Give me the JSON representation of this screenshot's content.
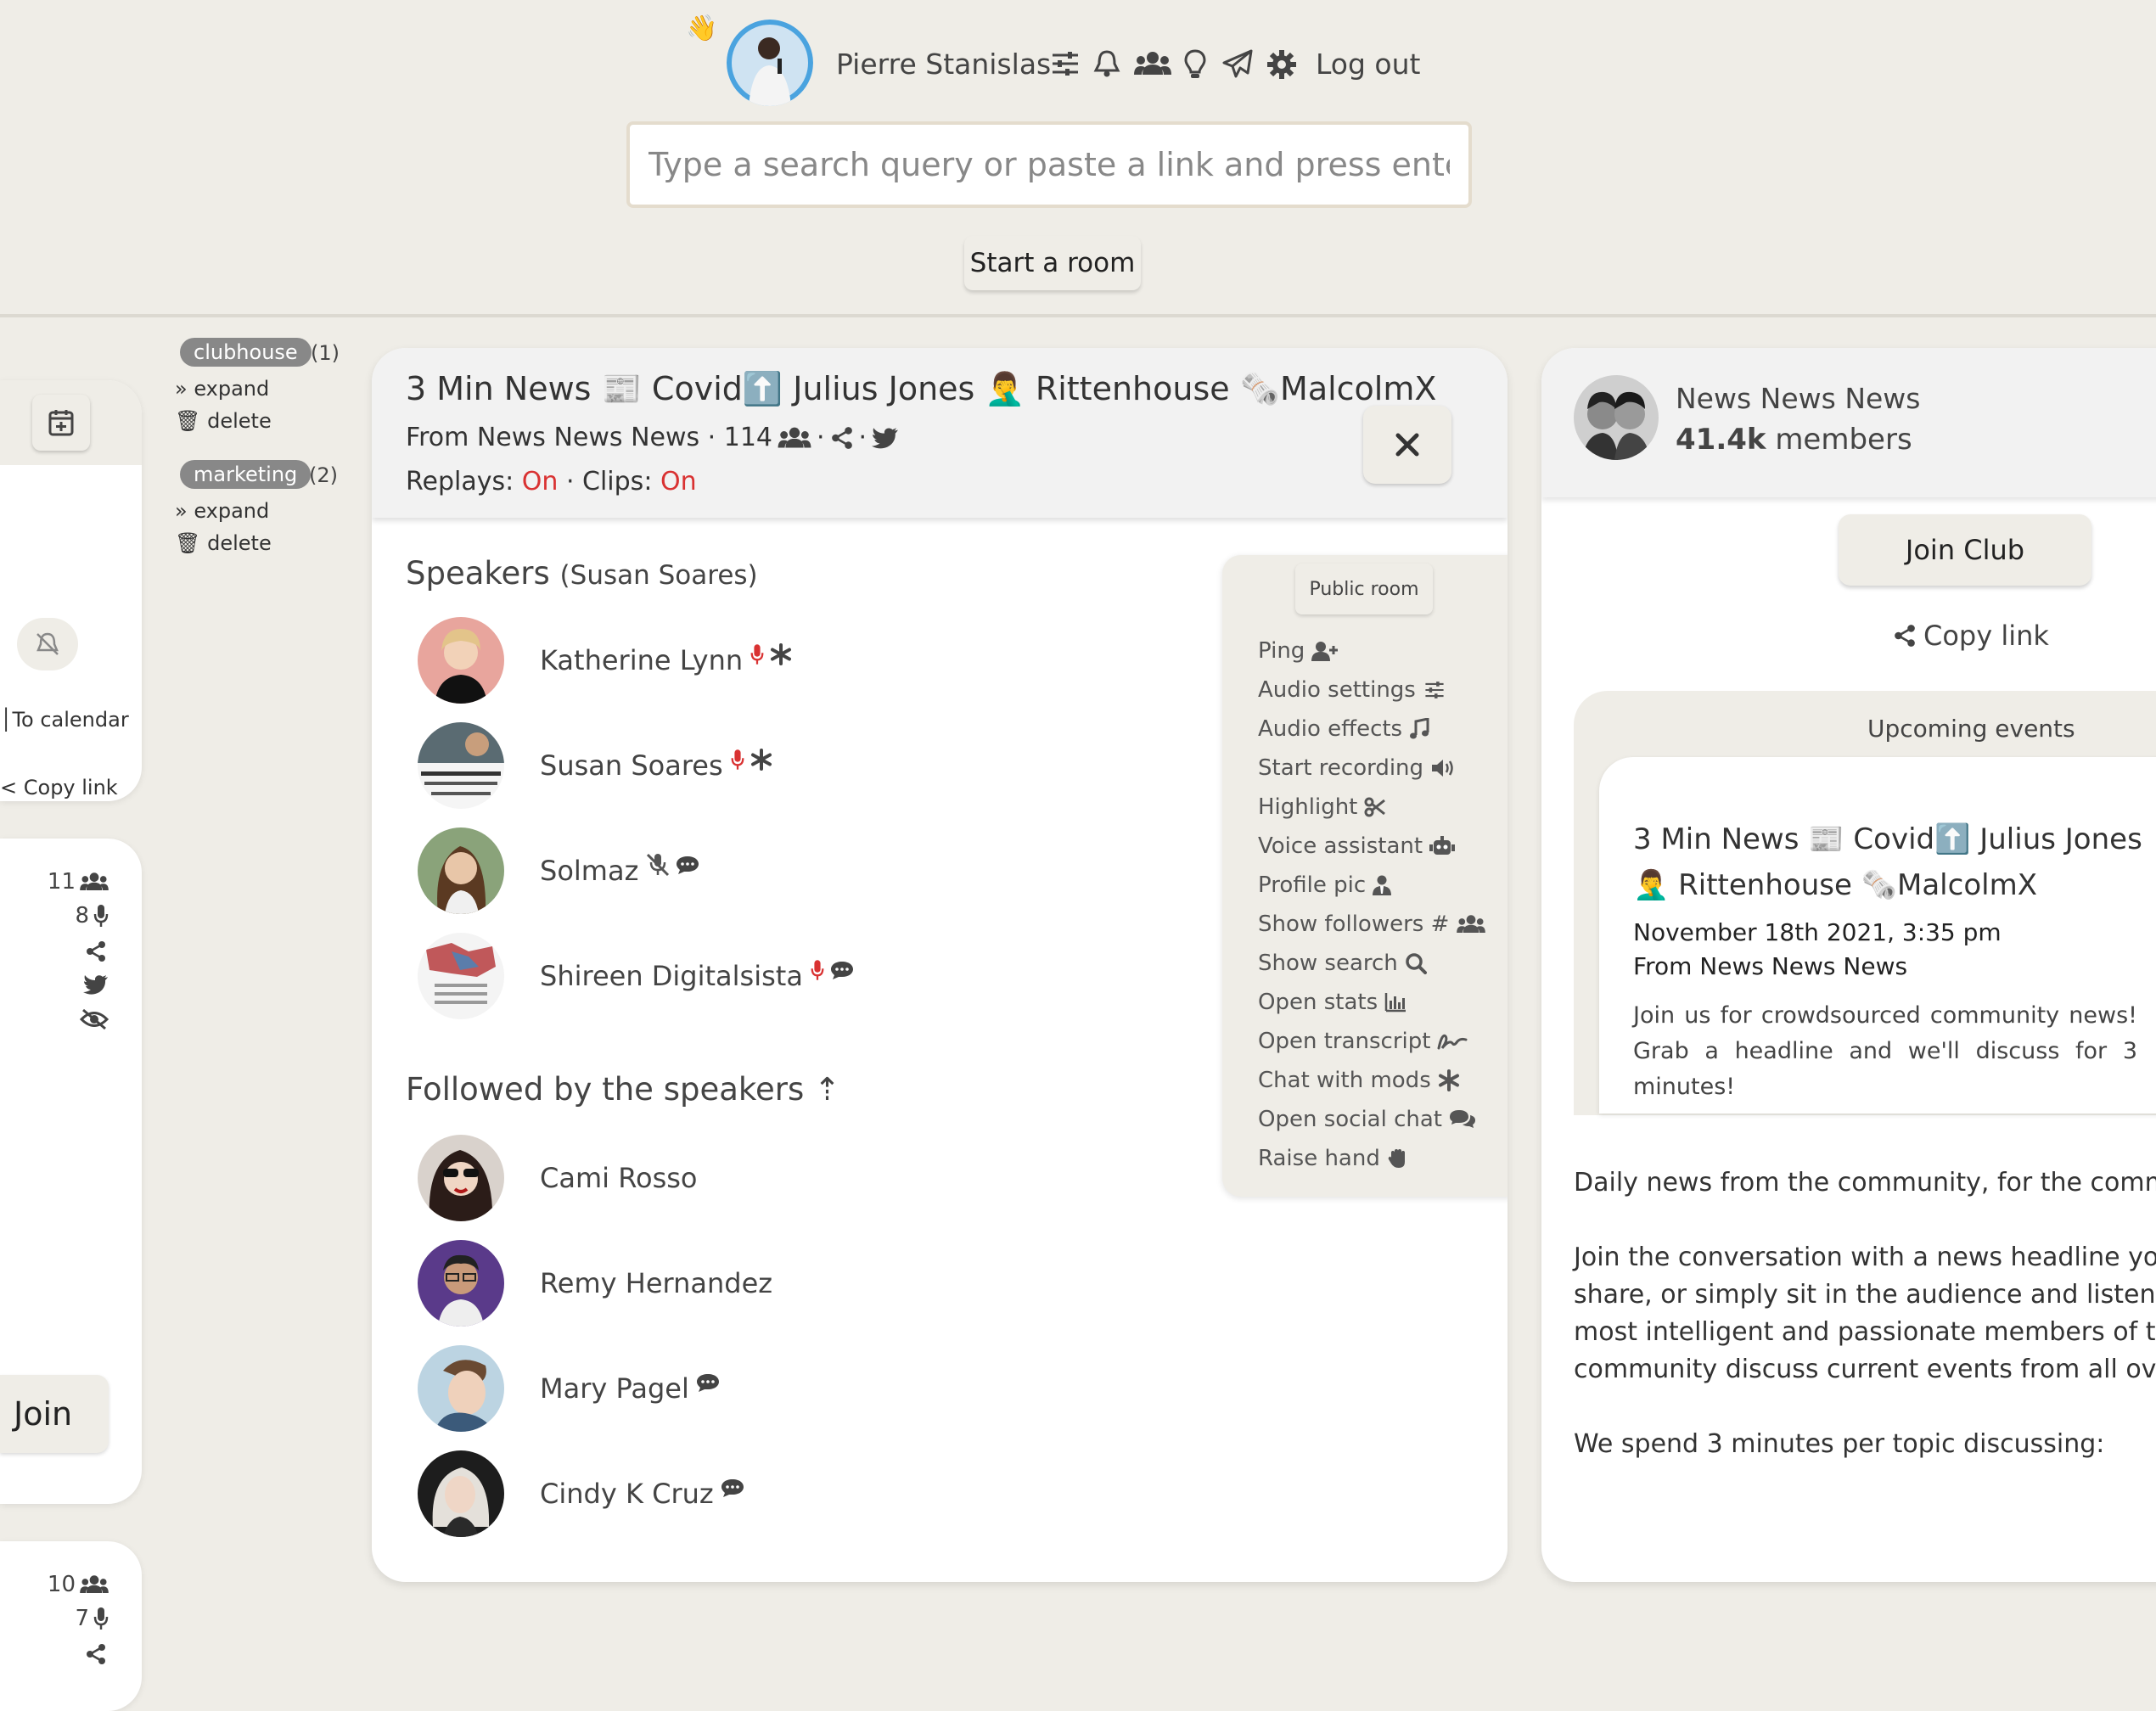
{
  "header": {
    "wave": "👋",
    "user_name": "Pierre Stanislas",
    "logout_label": "Log out",
    "icons": [
      "sliders-icon",
      "bell-icon",
      "users-icon",
      "lightbulb-icon",
      "paper-plane-icon",
      "gear-icon"
    ]
  },
  "search": {
    "placeholder": "Type a search query or paste a link and press enter",
    "value": ""
  },
  "start_room_label": "Start a room",
  "left_card": {
    "to_calendar": "To calendar",
    "copy_link": "Copy link",
    "join_label": "Join",
    "room2_stats": {
      "listeners": "11",
      "speakers": "8"
    },
    "room3_stats": {
      "listeners": "10",
      "speakers": "7"
    }
  },
  "tags": [
    {
      "name": "clubhouse",
      "count": "(1)",
      "expand": "expand",
      "delete": "delete"
    },
    {
      "name": "marketing",
      "count": "(2)",
      "expand": "expand",
      "delete": "delete"
    }
  ],
  "room": {
    "title": "3 Min News 📰 Covid⬆️ Julius Jones 🤦‍♂️ Rittenhouse 🗞️MalcolmX",
    "from": "From News News News · 114",
    "replays_label": "Replays:",
    "replays_value": "On",
    "clips_label": "· Clips:",
    "clips_value": "On",
    "speakers_heading": "Speakers",
    "speakers_moderator": "(Susan Soares)",
    "speakers": [
      {
        "name": "Katherine Lynn",
        "mic": "on",
        "badge": "asterisk"
      },
      {
        "name": "Susan Soares",
        "mic": "on",
        "badge": "asterisk"
      },
      {
        "name": "Solmaz",
        "mic": "off",
        "badge": "comment"
      },
      {
        "name": "Shireen Digitalsista",
        "mic": "on",
        "badge": "comment"
      }
    ],
    "followed_heading": "Followed by the speakers",
    "followed_arrow": "⇡",
    "followed": [
      {
        "name": "Cami Rosso",
        "badge": ""
      },
      {
        "name": "Remy Hernandez",
        "badge": ""
      },
      {
        "name": "Mary Pagel",
        "badge": "comment"
      },
      {
        "name": "Cindy K Cruz",
        "badge": "comment"
      }
    ],
    "public_room_label": "Public room",
    "menu": [
      {
        "label": "Ping",
        "icon": "user-plus-icon"
      },
      {
        "label": "Audio settings",
        "icon": "sliders-icon"
      },
      {
        "label": "Audio effects",
        "icon": "music-icon"
      },
      {
        "label": "Start recording",
        "icon": "volume-icon"
      },
      {
        "label": "Highlight",
        "icon": "scissors-icon"
      },
      {
        "label": "Voice assistant",
        "icon": "robot-icon"
      },
      {
        "label": "Profile pic",
        "icon": "user-tie-icon"
      },
      {
        "label": "Show followers #",
        "icon": "users-icon"
      },
      {
        "label": "Show search",
        "icon": "search-icon"
      },
      {
        "label": "Open stats",
        "icon": "chart-icon"
      },
      {
        "label": "Open transcript",
        "icon": "signature-icon"
      },
      {
        "label": "Chat with mods",
        "icon": "asterisk-icon"
      },
      {
        "label": "Open social chat",
        "icon": "comments-icon"
      },
      {
        "label": "Raise hand",
        "icon": "hand-icon"
      }
    ]
  },
  "club": {
    "name": "News News News",
    "members_count": "41.4k",
    "members_label": "members",
    "join_label": "Join Club",
    "copy_link_label": "Copy link",
    "events_heading": "Upcoming events",
    "event": {
      "title": "3 Min News 📰 Covid⬆️ Julius Jones 🤦‍♂️ Rittenhouse 🗞️MalcolmX",
      "date": "November 18th 2021, 3:35 pm",
      "from": "From News News News",
      "description": "Join us for crowdsourced community news! Grab a headline and we'll discuss for 3 minutes!"
    },
    "description_lines": [
      "Daily news from the community, for the commun",
      "",
      "Join the conversation with a news headline you w",
      "share, or simply sit in the audience and listen to",
      "most intelligent and passionate members of the",
      "community discuss current events from all over",
      "",
      "We spend 3 minutes per topic discussing:"
    ]
  },
  "colors": {
    "background": "#efede7",
    "accent_red": "#d93232",
    "tag_gray": "#888888",
    "panel_white": "#ffffff"
  }
}
